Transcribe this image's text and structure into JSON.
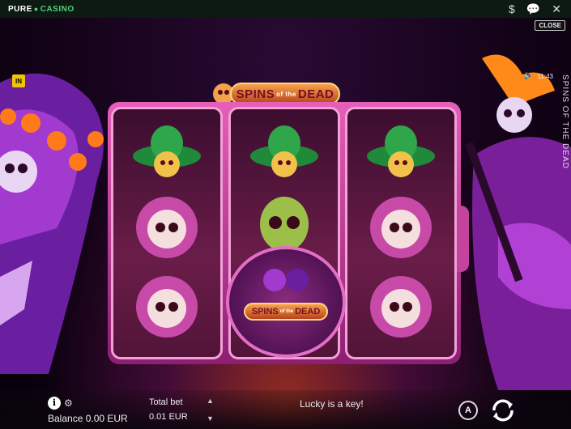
{
  "topbar": {
    "brand_prefix": "PURE",
    "brand_suffix": "CASINO",
    "icons": [
      "dollar-icon",
      "chat-icon",
      "close-x-icon"
    ]
  },
  "game": {
    "close_label": "CLOSE",
    "vertical_title": "SPINS OF THE DEAD",
    "clock": "11:43",
    "badge": "IN",
    "title_left": "SPINS",
    "title_mid": "of the",
    "title_right": "DEAD",
    "scatter_left": "SPINS",
    "scatter_mid": "of the",
    "scatter_right": "DEAD",
    "reels": [
      [
        "sombrero-skull",
        "flower-skull",
        "flower-skull"
      ],
      [
        "sombrero-skull",
        "green-skull",
        "scatter-logo"
      ],
      [
        "sombrero-skull",
        "flower-skull",
        "flower-skull"
      ]
    ],
    "colors": {
      "accent": "#e46ec6",
      "frame": "#c4439f",
      "plate": "#f7a24b"
    }
  },
  "footer": {
    "balance": "Balance 0.00 EUR",
    "bet_label": "Total bet",
    "bet_value": "0.01 EUR",
    "message": "Lucky is a key!",
    "auto_label": "A"
  }
}
